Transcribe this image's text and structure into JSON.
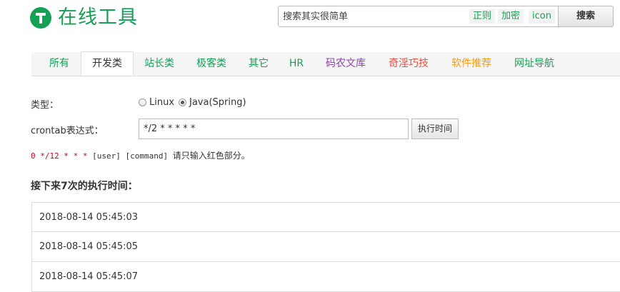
{
  "header": {
    "logo_text": "在线工具",
    "search_placeholder": "搜索其实很简单",
    "chips": [
      "正则",
      "加密",
      "icon"
    ],
    "search_button": "搜索",
    "brand_color": "#15a055"
  },
  "tabs": [
    {
      "label": "所有",
      "color": "#15a055"
    },
    {
      "label": "开发类",
      "color": "#333333"
    },
    {
      "label": "站长类",
      "color": "#15a055"
    },
    {
      "label": "极客类",
      "color": "#15a055"
    },
    {
      "label": "其它",
      "color": "#15a055"
    },
    {
      "label": "HR",
      "color": "#15a055"
    },
    {
      "label": "码农文库",
      "color": "#8e44ad"
    },
    {
      "label": "奇淫巧技",
      "color": "#e74c3c"
    },
    {
      "label": "软件推荐",
      "color": "#f39c12"
    },
    {
      "label": "网址导航",
      "color": "#15a055"
    }
  ],
  "active_tab": "开发类",
  "form": {
    "type_label": "类型：",
    "options": [
      "Linux",
      "Java(Spring)"
    ],
    "selected_option": "Java(Spring)",
    "crontab_label": "crontab表达式：",
    "crontab_value": "*/2 * * * * *",
    "exec_button": "执行时间",
    "hint_red": "0 */12 * * *",
    "hint_mono": " [user] [command] ",
    "hint_text": "请只输入红色部分。"
  },
  "results": {
    "title": "接下来7次的执行时间：",
    "times": [
      "2018-08-14 05:45:03",
      "2018-08-14 05:45:05",
      "2018-08-14 05:45:07"
    ]
  }
}
